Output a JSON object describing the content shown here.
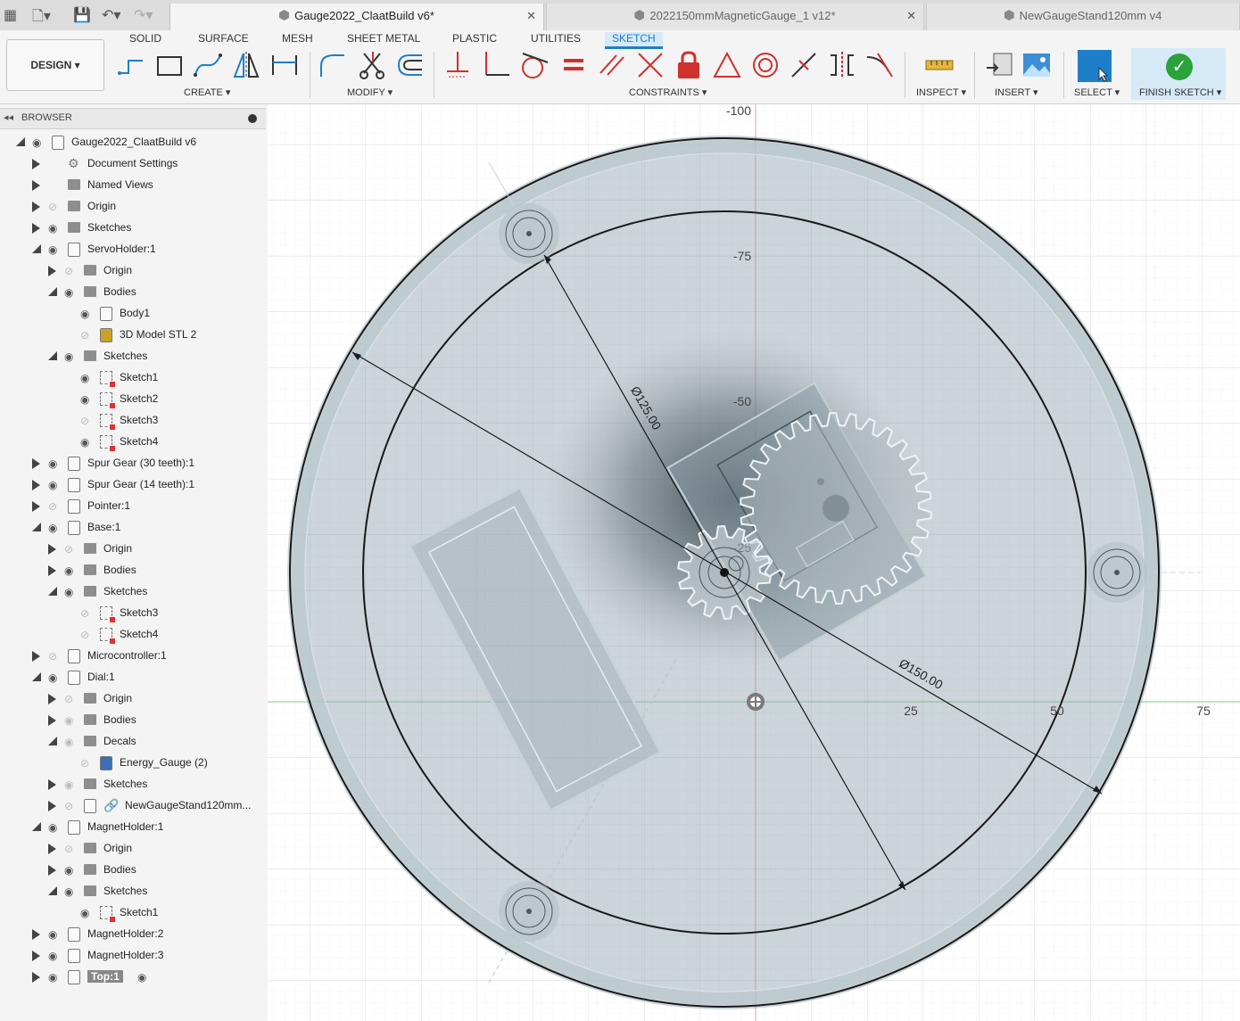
{
  "tabs": [
    {
      "label": "Gauge2022_ClaatBuild v6*",
      "active": true
    },
    {
      "label": "2022150mmMagneticGauge_1 v12*",
      "active": false
    },
    {
      "label": "NewGaugeStand120mm v4",
      "active": false
    }
  ],
  "ribbon": {
    "tabs": [
      "SOLID",
      "SURFACE",
      "MESH",
      "SHEET METAL",
      "PLASTIC",
      "UTILITIES",
      "SKETCH"
    ],
    "active_tab": "SKETCH",
    "workspace": "DESIGN ▾",
    "groups": {
      "create": "CREATE ▾",
      "modify": "MODIFY ▾",
      "constraints": "CONSTRAINTS ▾",
      "inspect": "INSPECT ▾",
      "insert": "INSERT ▾",
      "select": "SELECT ▾",
      "finish": "FINISH SKETCH ▾"
    }
  },
  "browser": {
    "title": "BROWSER",
    "items": [
      {
        "label": "Gauge2022_ClaatBuild v6",
        "indent": 0,
        "expand": "down",
        "eye": "on",
        "icon": "doc"
      },
      {
        "label": "Document Settings",
        "indent": 1,
        "expand": "right",
        "eye": "none",
        "icon": "gear"
      },
      {
        "label": "Named Views",
        "indent": 1,
        "expand": "right",
        "eye": "none",
        "icon": "folder"
      },
      {
        "label": "Origin",
        "indent": 1,
        "expand": "right",
        "eye": "off",
        "icon": "folder"
      },
      {
        "label": "Sketches",
        "indent": 1,
        "expand": "right",
        "eye": "on",
        "icon": "folder"
      },
      {
        "label": "ServoHolder:1",
        "indent": 1,
        "expand": "down",
        "eye": "on",
        "icon": "body"
      },
      {
        "label": "Origin",
        "indent": 2,
        "expand": "right",
        "eye": "off",
        "icon": "folder"
      },
      {
        "label": "Bodies",
        "indent": 2,
        "expand": "down",
        "eye": "on",
        "icon": "folder"
      },
      {
        "label": "Body1",
        "indent": 3,
        "expand": "none",
        "eye": "on",
        "icon": "body"
      },
      {
        "label": "3D Model STL 2",
        "indent": 3,
        "expand": "none",
        "eye": "off",
        "icon": "mesh"
      },
      {
        "label": "Sketches",
        "indent": 2,
        "expand": "down",
        "eye": "on",
        "icon": "folder"
      },
      {
        "label": "Sketch1",
        "indent": 3,
        "expand": "none",
        "eye": "on",
        "icon": "sketch"
      },
      {
        "label": "Sketch2",
        "indent": 3,
        "expand": "none",
        "eye": "on",
        "icon": "sketch"
      },
      {
        "label": "Sketch3",
        "indent": 3,
        "expand": "none",
        "eye": "off",
        "icon": "sketch"
      },
      {
        "label": "Sketch4",
        "indent": 3,
        "expand": "none",
        "eye": "on",
        "icon": "sketch"
      },
      {
        "label": "Spur Gear (30 teeth):1",
        "indent": 1,
        "expand": "right",
        "eye": "on",
        "icon": "body"
      },
      {
        "label": "Spur Gear (14 teeth):1",
        "indent": 1,
        "expand": "right",
        "eye": "on",
        "icon": "body"
      },
      {
        "label": "Pointer:1",
        "indent": 1,
        "expand": "right",
        "eye": "off",
        "icon": "body"
      },
      {
        "label": "Base:1",
        "indent": 1,
        "expand": "down",
        "eye": "on",
        "icon": "body"
      },
      {
        "label": "Origin",
        "indent": 2,
        "expand": "right",
        "eye": "off",
        "icon": "folder"
      },
      {
        "label": "Bodies",
        "indent": 2,
        "expand": "right",
        "eye": "on",
        "icon": "folder"
      },
      {
        "label": "Sketches",
        "indent": 2,
        "expand": "down",
        "eye": "on",
        "icon": "folder"
      },
      {
        "label": "Sketch3",
        "indent": 3,
        "expand": "none",
        "eye": "off",
        "icon": "sketch"
      },
      {
        "label": "Sketch4",
        "indent": 3,
        "expand": "none",
        "eye": "off",
        "icon": "sketch"
      },
      {
        "label": "Microcontroller:1",
        "indent": 1,
        "expand": "right",
        "eye": "off",
        "icon": "body"
      },
      {
        "label": "Dial:1",
        "indent": 1,
        "expand": "down",
        "eye": "on",
        "icon": "doc"
      },
      {
        "label": "Origin",
        "indent": 2,
        "expand": "right",
        "eye": "off",
        "icon": "folder"
      },
      {
        "label": "Bodies",
        "indent": 2,
        "expand": "right",
        "eye": "dim",
        "icon": "folder"
      },
      {
        "label": "Decals",
        "indent": 2,
        "expand": "down",
        "eye": "dim",
        "icon": "folder"
      },
      {
        "label": "Energy_Gauge (2)",
        "indent": 3,
        "expand": "none",
        "eye": "off",
        "icon": "decal"
      },
      {
        "label": "Sketches",
        "indent": 2,
        "expand": "right",
        "eye": "dim",
        "icon": "folder"
      },
      {
        "label": "NewGaugeStand120mm...",
        "indent": 2,
        "expand": "right",
        "eye": "off",
        "icon": "link"
      },
      {
        "label": "MagnetHolder:1",
        "indent": 1,
        "expand": "down",
        "eye": "on",
        "icon": "body"
      },
      {
        "label": "Origin",
        "indent": 2,
        "expand": "right",
        "eye": "off",
        "icon": "folder"
      },
      {
        "label": "Bodies",
        "indent": 2,
        "expand": "right",
        "eye": "on",
        "icon": "folder"
      },
      {
        "label": "Sketches",
        "indent": 2,
        "expand": "down",
        "eye": "on",
        "icon": "folder"
      },
      {
        "label": "Sketch1",
        "indent": 3,
        "expand": "none",
        "eye": "on",
        "icon": "sketch"
      },
      {
        "label": "MagnetHolder:2",
        "indent": 1,
        "expand": "right",
        "eye": "on",
        "icon": "body"
      },
      {
        "label": "MagnetHolder:3",
        "indent": 1,
        "expand": "right",
        "eye": "on",
        "icon": "body"
      },
      {
        "label": "Top:1",
        "indent": 1,
        "expand": "right",
        "eye": "on",
        "icon": "body",
        "active": true
      }
    ]
  },
  "canvas": {
    "ruler_labels": [
      "-100",
      "-75",
      "-50",
      "-25",
      "25",
      "50",
      "75"
    ],
    "dimensions": [
      "Ø125.00",
      "Ø150.00"
    ]
  },
  "colors": {
    "accent": "#1e7ec8",
    "finish_green": "#29a33a",
    "sketch_red": "#d0312d"
  }
}
